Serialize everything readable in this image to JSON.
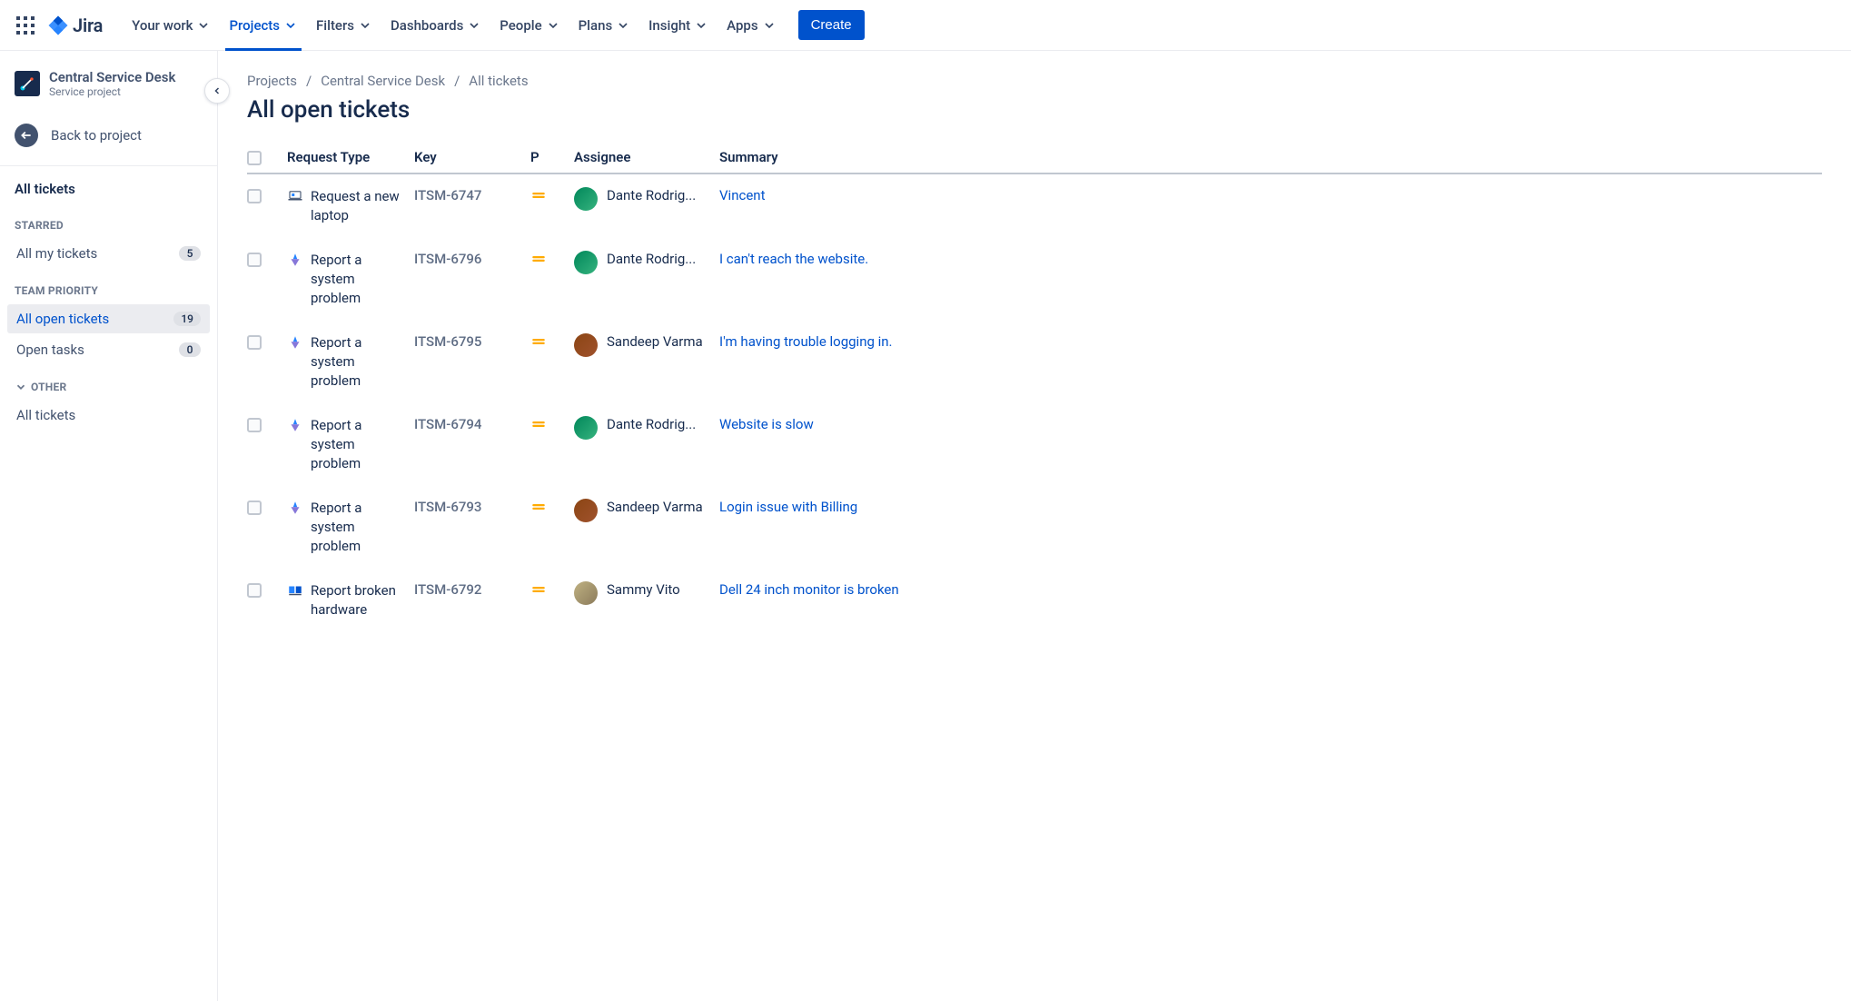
{
  "brand": "Jira",
  "nav": {
    "items": [
      {
        "label": "Your work"
      },
      {
        "label": "Projects",
        "active": true
      },
      {
        "label": "Filters"
      },
      {
        "label": "Dashboards"
      },
      {
        "label": "People"
      },
      {
        "label": "Plans"
      },
      {
        "label": "Insight"
      },
      {
        "label": "Apps"
      }
    ],
    "create": "Create"
  },
  "sidebar": {
    "project_name": "Central Service Desk",
    "project_type": "Service project",
    "back_label": "Back to project",
    "heading": "All tickets",
    "groups": {
      "starred": {
        "label": "STARRED",
        "items": [
          {
            "label": "All my tickets",
            "count": "5"
          }
        ]
      },
      "team_priority": {
        "label": "TEAM PRIORITY",
        "items": [
          {
            "label": "All open tickets",
            "count": "19",
            "active": true
          },
          {
            "label": "Open tasks",
            "count": "0"
          }
        ]
      },
      "other": {
        "label": "OTHER",
        "items": [
          {
            "label": "All tickets"
          }
        ]
      }
    }
  },
  "breadcrumb": [
    "Projects",
    "Central Service Desk",
    "All tickets"
  ],
  "page_title": "All open tickets",
  "columns": {
    "request_type": "Request Type",
    "key": "Key",
    "priority": "P",
    "assignee": "Assignee",
    "summary": "Summary"
  },
  "rows": [
    {
      "type": "Request a new laptop",
      "type_icon": "laptop",
      "key": "ITSM-6747",
      "assignee": "Dante Rodrig...",
      "avatar": "g",
      "summary": "Vincent"
    },
    {
      "type": "Report a system problem",
      "type_icon": "system",
      "key": "ITSM-6796",
      "assignee": "Dante Rodrig...",
      "avatar": "g",
      "summary": "I can't reach the website."
    },
    {
      "type": "Report a system problem",
      "type_icon": "system",
      "key": "ITSM-6795",
      "assignee": "Sandeep Varma",
      "avatar": "b",
      "summary": "I'm having trouble logging in."
    },
    {
      "type": "Report a system problem",
      "type_icon": "system",
      "key": "ITSM-6794",
      "assignee": "Dante Rodrig...",
      "avatar": "g",
      "summary": "Website is slow"
    },
    {
      "type": "Report a system problem",
      "type_icon": "system",
      "key": "ITSM-6793",
      "assignee": "Sandeep Varma",
      "avatar": "b",
      "summary": "Login issue with Billing"
    },
    {
      "type": "Report broken hardware",
      "type_icon": "hardware",
      "key": "ITSM-6792",
      "assignee": "Sammy Vito",
      "avatar": "p",
      "summary": "Dell 24 inch monitor is broken"
    }
  ]
}
